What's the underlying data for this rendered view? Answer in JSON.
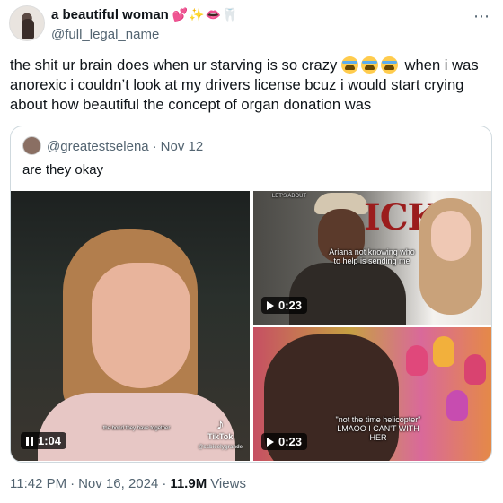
{
  "author": {
    "display_name": "a beautiful woman",
    "badges": "💕✨👄🦷",
    "handle": "@full_legal_name"
  },
  "more_icon": "⋯",
  "tweet": {
    "text_part1": "the shit ur brain does when ur starving is so crazy ",
    "emoji": "loudly-crying-face x3",
    "text_part2": " when i was anorexic i couldn’t look at my drivers license bcuz i would start crying about how beautiful the concept of organ donation was"
  },
  "quote": {
    "handle": "@greatestselena",
    "separator": "·",
    "date": "Nov 12",
    "text": "are they okay",
    "media": [
      {
        "duration": "1:04",
        "state": "paused",
        "caption": "the bond they have together",
        "tiktok_label": "TikTok",
        "tiktok_user": "@ssbicelygrande"
      },
      {
        "duration": "0:23",
        "state": "play",
        "caption": "Ariana not knowing who to help is sending me",
        "overlay_text": "ICK",
        "top_label": "LET'S ABOUT"
      },
      {
        "duration": "0:23",
        "state": "play",
        "caption": "\"not the time helicopter\" LMAOO I CAN'T WITH HER"
      }
    ]
  },
  "footer": {
    "time": "11:42 PM",
    "separator": "·",
    "date": "Nov 16, 2024",
    "separator2": "·",
    "views_count": "11.9M",
    "views_label": "Views"
  }
}
